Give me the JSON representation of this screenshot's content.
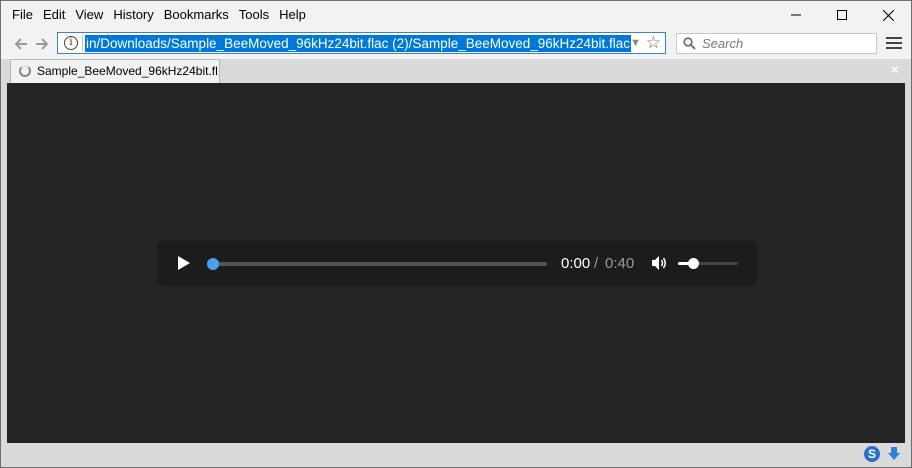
{
  "menu": [
    "File",
    "Edit",
    "View",
    "History",
    "Bookmarks",
    "Tools",
    "Help"
  ],
  "window_controls": [
    "minimize-icon",
    "maximize-icon",
    "close-icon"
  ],
  "navbar": {
    "url": "in/Downloads/Sample_BeeMoved_96kHz24bit.flac (2)/Sample_BeeMoved_96kHz24bit.flac",
    "info_glyph": "i",
    "search_placeholder": "Search"
  },
  "tab": {
    "title": "Sample_BeeMoved_96kHz24bit.fl",
    "close_glyph": "×"
  },
  "player": {
    "time_current": "0:00",
    "time_separator": "/",
    "time_total": "0:40",
    "progress_fraction": 0,
    "volume_fraction": 0.25,
    "accent_color": "#4d9ff5"
  },
  "statusbar": {
    "s_badge": "S"
  }
}
